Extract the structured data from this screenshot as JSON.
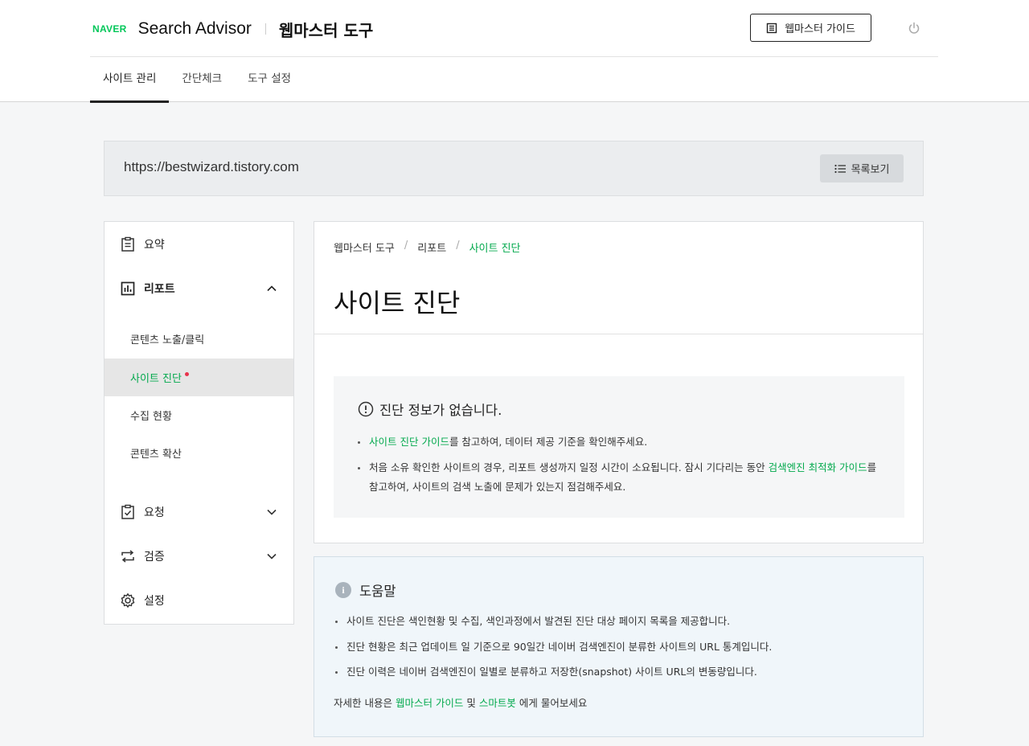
{
  "header": {
    "naver_logo": "NAVER",
    "brand": "Search Advisor",
    "brand_kr": "웹마스터 도구",
    "guide_button": "웹마스터 가이드",
    "tabs": [
      {
        "label": "사이트 관리"
      },
      {
        "label": "간단체크"
      },
      {
        "label": "도구 설정"
      }
    ]
  },
  "site": {
    "url": "https://bestwizard.tistory.com",
    "list_button": "목록보기"
  },
  "sidebar": {
    "summary": "요약",
    "report": "리포트",
    "report_items": [
      "콘텐츠 노출/클릭",
      "사이트 진단",
      "수집 현황",
      "콘텐츠 확산"
    ],
    "request": "요청",
    "verify": "검증",
    "settings": "설정"
  },
  "main": {
    "breadcrumb": [
      "웹마스터 도구",
      "리포트",
      "사이트 진단"
    ],
    "breadcrumb_sep": "/",
    "title": "사이트 진단",
    "notice": {
      "title": "진단 정보가 없습니다.",
      "b1_link": "사이트 진단 가이드",
      "b1_text": "를 참고하여, 데이터 제공 기준을 확인해주세요.",
      "b2_text_a": "처음 소유 확인한 사이트의 경우, 리포트 생성까지 일정 시간이 소요됩니다. 잠시 기다리는 동안 ",
      "b2_link": "검색엔진 최적화 가이드",
      "b2_text_b": "를 참고하여, 사이트의 검색 노출에 문제가 있는지 점검해주세요."
    }
  },
  "help": {
    "title": "도움말",
    "items": [
      "사이트 진단은 색인현황 및 수집, 색인과정에서 발견된 진단 대상 페이지 목록을 제공합니다.",
      "진단 현황은 최근 업데이트 일 기준으로 90일간 네이버 검색엔진이 분류한 사이트의 URL 통계입니다.",
      "진단 이력은 네이버 검색엔진이 일별로 분류하고 저장한(snapshot) 사이트 URL의 변동량입니다."
    ],
    "foot_a": "자세한 내용은 ",
    "foot_link1": "웹마스터 가이드",
    "foot_b": " 및 ",
    "foot_link2": "스마트봇",
    "foot_c": " 에게 물어보세요"
  },
  "colors": {
    "accent": "#03a94d",
    "naver_green": "#03c75a",
    "alert_dot": "#e8334c"
  }
}
